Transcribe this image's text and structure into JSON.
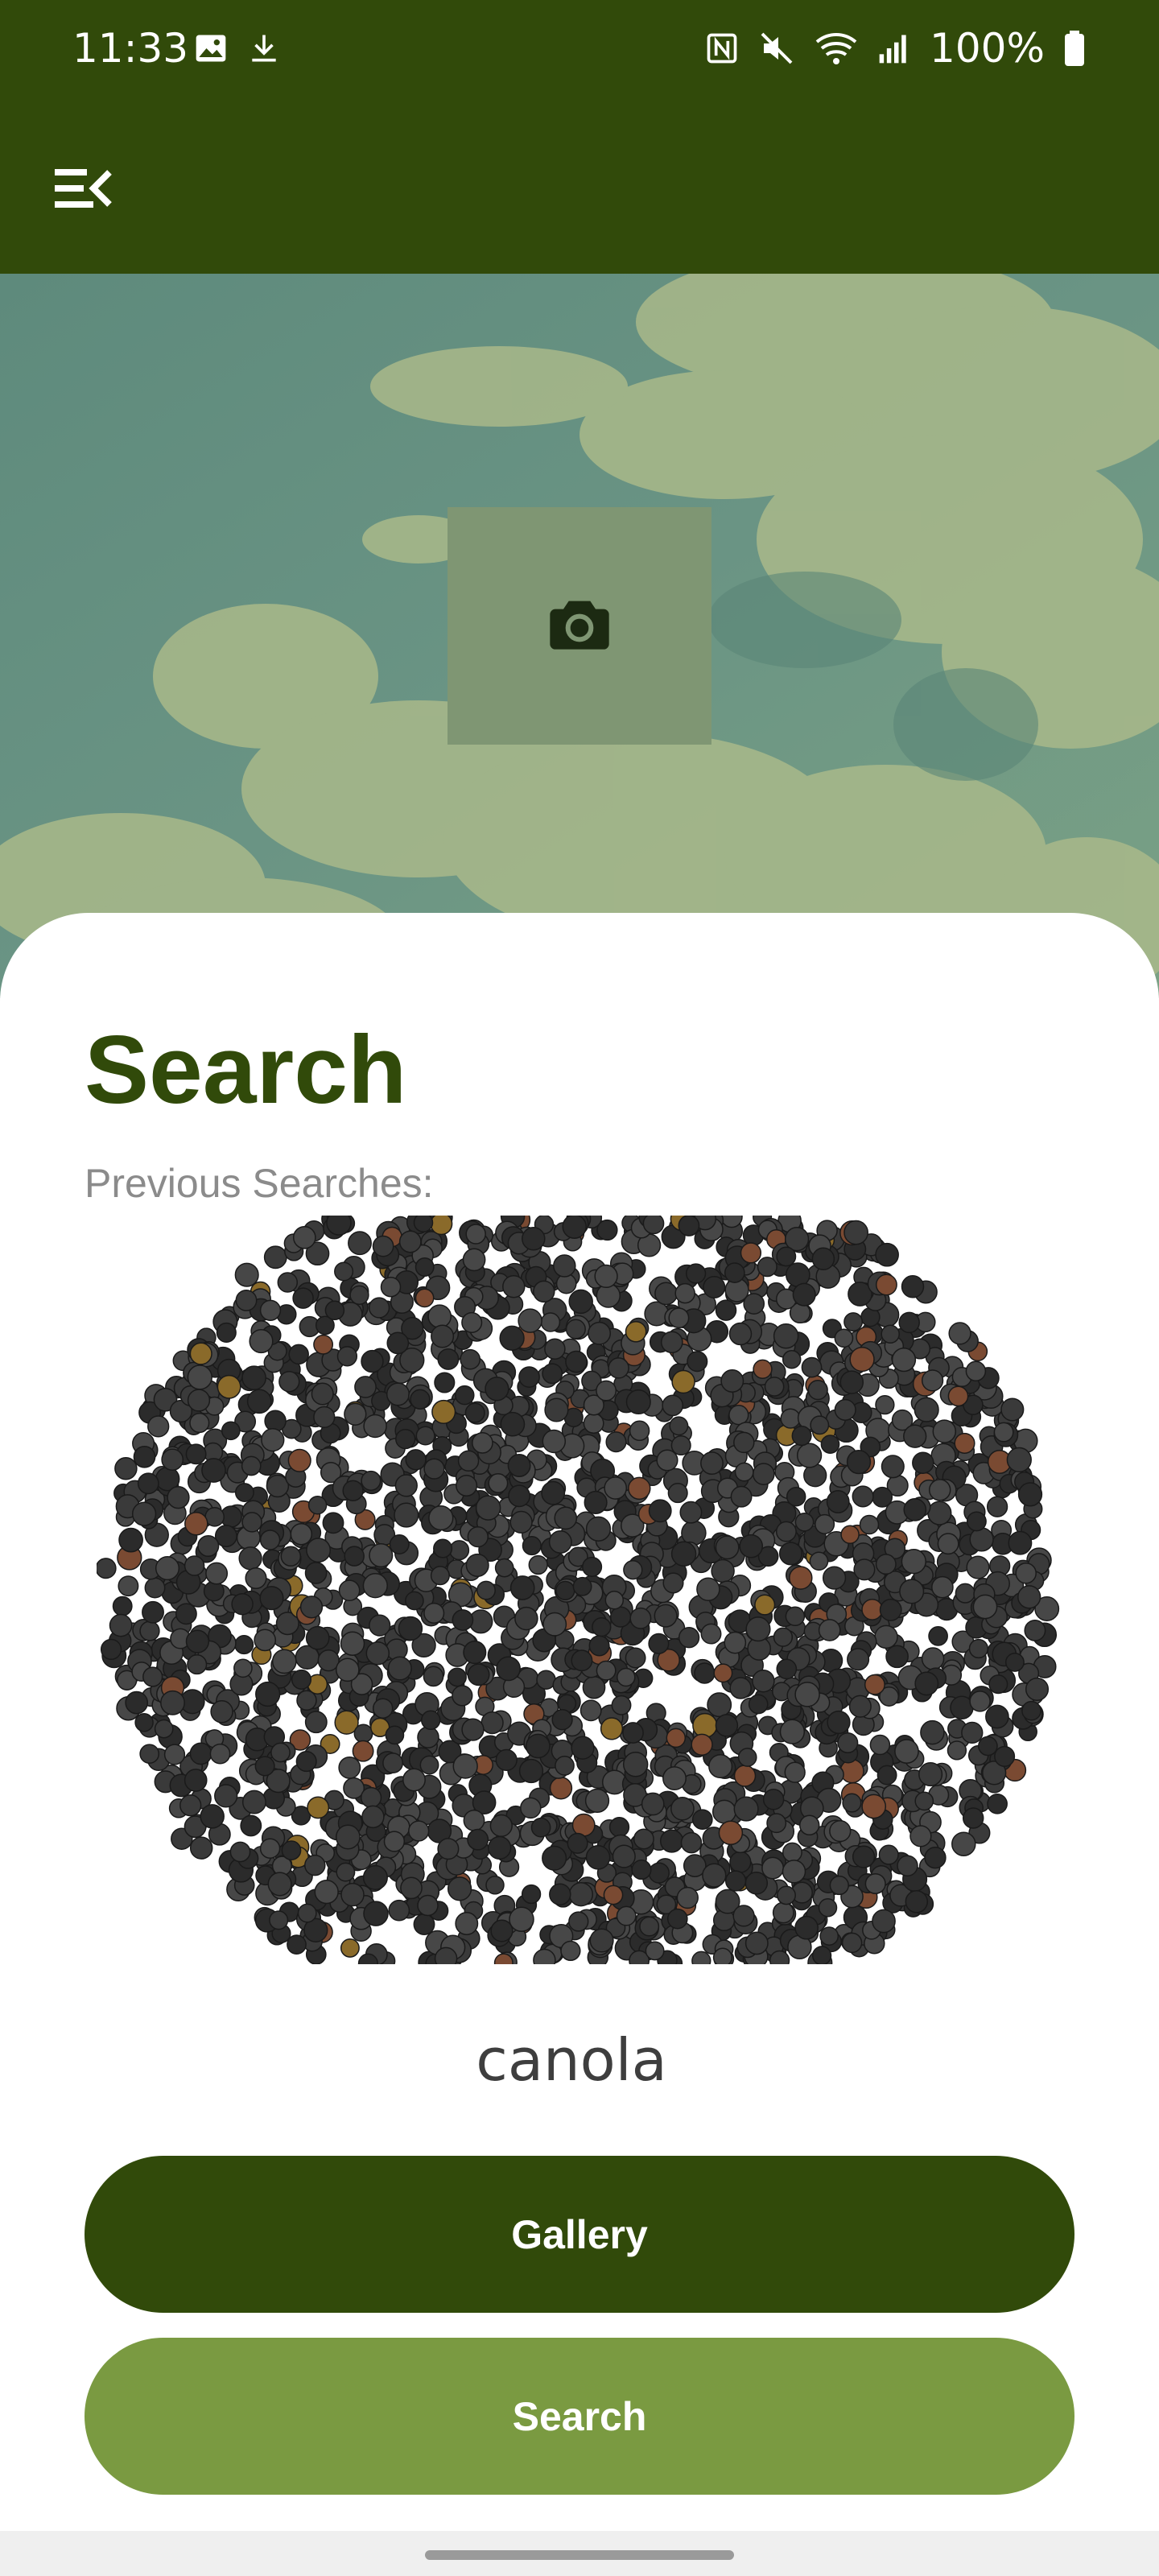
{
  "status_bar": {
    "time": "11:33",
    "battery": "100%",
    "left_icons": [
      "image-icon",
      "download-icon"
    ],
    "right_icons": [
      "nfc-icon",
      "mute-icon",
      "wifi-icon",
      "signal-icon",
      "battery-icon"
    ]
  },
  "app_bar": {
    "menu_icon": "menu-collapse-icon"
  },
  "hero": {
    "camera_icon": "camera-icon"
  },
  "sheet": {
    "title": "Search",
    "subtitle": "Previous Searches:",
    "result_label": "canola",
    "gallery_button": "Gallery",
    "search_button": "Search"
  },
  "colors": {
    "primary": "#314a0a",
    "secondary": "#7a9a41",
    "muted_text": "#8b8b8b"
  }
}
